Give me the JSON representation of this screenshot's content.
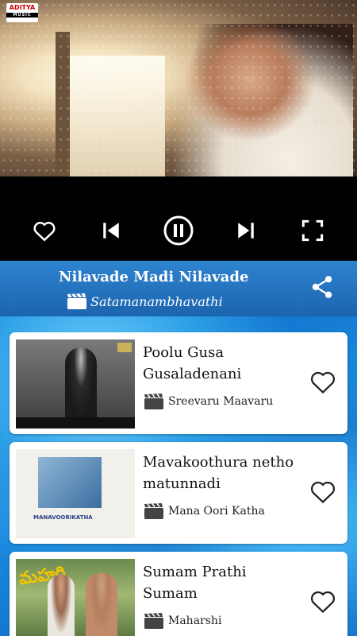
{
  "video": {
    "brand_logo_text": "ADITYA",
    "brand_logo_subtext": "MUSIC",
    "watermark": "ADITYA"
  },
  "player_controls": [
    {
      "name": "favorite-icon"
    },
    {
      "name": "previous-icon"
    },
    {
      "name": "pause-icon"
    },
    {
      "name": "next-icon"
    },
    {
      "name": "fullscreen-icon"
    }
  ],
  "now_playing": {
    "title": "Nilavade Madi Nilavade",
    "movie": "Satamanambhavathi",
    "movie_icon": "clapperboard-icon",
    "share_icon": "share-icon"
  },
  "songs": [
    {
      "title": "Poolu Gusa Gusaladenani",
      "movie": "Sreevaru Maavaru",
      "favorite": false
    },
    {
      "title": "Mavakoothura netho matunnadi",
      "movie": "Mana Oori Katha",
      "favorite": false,
      "thumb_text": "MANAVOORIKATHA"
    },
    {
      "title": "Sumam Prathi Sumam",
      "movie": "Maharshi",
      "favorite": false,
      "thumb_logo": "మహర్షి"
    }
  ],
  "colors": {
    "now_playing_bar": "#1e6bb3",
    "list_background": "#1a86d8",
    "card": "#ffffff"
  }
}
